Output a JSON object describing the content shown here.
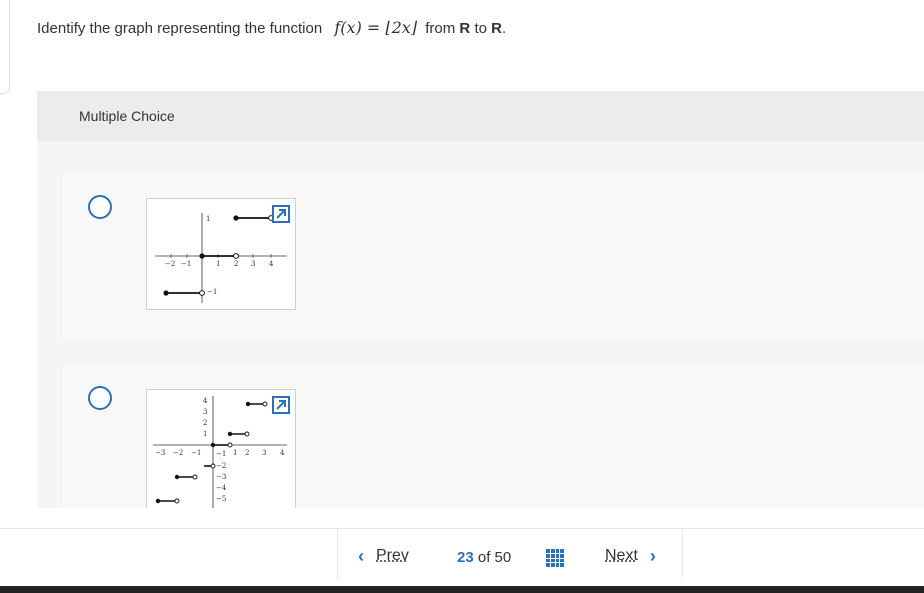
{
  "question": {
    "prefix": "Identify the graph representing the function",
    "math": "f(x) = ⌊2x⌋",
    "mid": "from",
    "set1": "R",
    "to": "to",
    "set2": "R",
    "end": "."
  },
  "panel": {
    "title": "Multiple Choice"
  },
  "options": [
    {
      "graph_labels": {
        "x_ticks": [
          "−2",
          "−1",
          "1",
          "2",
          "3",
          "4"
        ],
        "y_ticks": [
          "1",
          "−1"
        ]
      }
    },
    {
      "graph_labels": {
        "x_ticks": [
          "−3",
          "−2",
          "−1",
          "1",
          "2",
          "3",
          "4"
        ],
        "y_ticks_pos": [
          "4",
          "3",
          "2",
          "1"
        ],
        "y_ticks_neg": [
          "−1",
          "−2",
          "−3",
          "−4",
          "−5"
        ]
      }
    }
  ],
  "navigation": {
    "prev_label": "Prev",
    "next_label": "Next",
    "current": "23",
    "of": "of",
    "total": "50",
    "prev_icon": "chevron-left-icon",
    "next_icon": "chevron-right-icon",
    "grid_icon": "grid-icon"
  },
  "colors": {
    "accent": "#2d70b7"
  }
}
